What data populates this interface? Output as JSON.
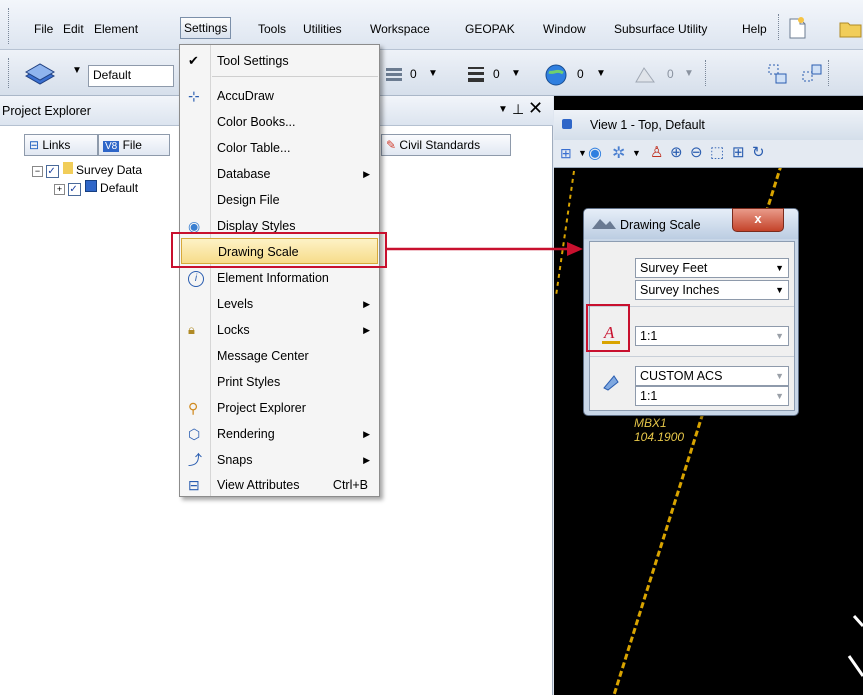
{
  "menubar": {
    "items": [
      {
        "label": "File"
      },
      {
        "label": "Edit"
      },
      {
        "label": "Element"
      },
      {
        "label": "Settings"
      },
      {
        "label": "Tools"
      },
      {
        "label": "Utilities"
      },
      {
        "label": "Workspace"
      },
      {
        "label": "GEOPAK"
      },
      {
        "label": "Window"
      },
      {
        "label": "Subsurface Utility"
      },
      {
        "label": "Help"
      }
    ]
  },
  "toolbar": {
    "level_combo": "Default",
    "color_value": "0",
    "weight_value": "0",
    "style_value": "0",
    "transparency_value": "0"
  },
  "project_explorer": {
    "title": "Project Explorer",
    "tabs": [
      {
        "label": "Links"
      },
      {
        "label": "File"
      },
      {
        "label": "Civil Standards"
      }
    ],
    "tree": [
      {
        "label": "Survey Data"
      },
      {
        "label": "Default"
      }
    ]
  },
  "settings_menu": {
    "items": [
      {
        "label": "Tool Settings",
        "icon": "checkmark-icon"
      },
      {
        "label": "AccuDraw",
        "icon": "accudraw-icon"
      },
      {
        "label": "Color Books..."
      },
      {
        "label": "Color Table..."
      },
      {
        "label": "Database",
        "submenu": true
      },
      {
        "label": "Design File"
      },
      {
        "label": "Display Styles",
        "icon": "display-styles-icon"
      },
      {
        "label": "Drawing Scale",
        "highlighted": true
      },
      {
        "label": "Element Information",
        "icon": "info-icon"
      },
      {
        "label": "Levels",
        "submenu": true
      },
      {
        "label": "Locks",
        "icon": "lock-icon",
        "submenu": true
      },
      {
        "label": "Message Center"
      },
      {
        "label": "Print Styles"
      },
      {
        "label": "Project Explorer",
        "icon": "project-explorer-icon"
      },
      {
        "label": "Rendering",
        "icon": "rendering-icon",
        "submenu": true
      },
      {
        "label": "Snaps",
        "icon": "snaps-icon",
        "submenu": true
      },
      {
        "label": "View Attributes",
        "icon": "view-attributes-icon",
        "shortcut": "Ctrl+B"
      }
    ]
  },
  "view": {
    "title": "View 1 - Top, Default",
    "annotation_line1": "MBX1",
    "annotation_line2": "104.1900"
  },
  "drawing_scale_dialog": {
    "title": "Drawing Scale",
    "close_label": "x",
    "master_units": "Survey Feet",
    "sub_units": "Survey Inches",
    "annotation_scale": "1:1",
    "acs_name": "CUSTOM ACS",
    "acs_scale": "1:1"
  },
  "colors": {
    "highlight_border": "#c8102e",
    "menu_highlight": "#f7dc8a",
    "annotation_text": "#e8c84a"
  }
}
